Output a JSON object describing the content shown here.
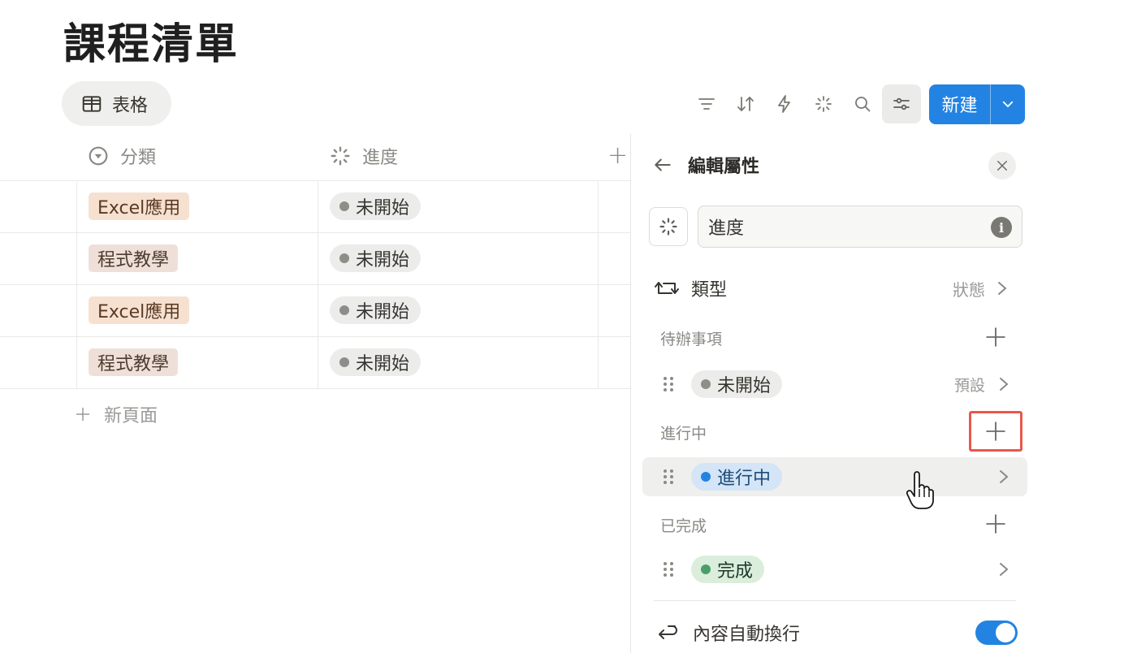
{
  "page": {
    "title": "課程清單"
  },
  "view": {
    "label": "表格"
  },
  "toolbar": {
    "icons": [
      "filter-icon",
      "sort-icon",
      "lightning-icon",
      "sparkle-icon",
      "search-icon",
      "settings-sliders-icon"
    ],
    "new_label": "新建"
  },
  "table": {
    "columns": [
      {
        "label": "分類",
        "icon": "select-icon"
      },
      {
        "label": "進度",
        "icon": "status-icon"
      }
    ],
    "rows": [
      {
        "category": "Excel應用",
        "status": "未開始"
      },
      {
        "category": "程式教學",
        "status": "未開始"
      },
      {
        "category": "Excel應用",
        "status": "未開始"
      },
      {
        "category": "程式教學",
        "status": "未開始"
      }
    ],
    "new_page_label": "新頁面"
  },
  "panel": {
    "title": "編輯屬性",
    "property_name": "進度",
    "type_label": "類型",
    "type_value": "狀態",
    "groups": [
      {
        "name": "待辦事項",
        "option": "未開始",
        "note": "預設",
        "color": "#8f8d88"
      },
      {
        "name": "進行中",
        "option": "進行中",
        "note": "",
        "color": "#2383e2"
      },
      {
        "name": "已完成",
        "option": "完成",
        "note": "",
        "color": "#4a9e6b"
      }
    ],
    "wrap_label": "內容自動換行",
    "wrap_enabled": true
  },
  "colors": {
    "accent": "#2383e2",
    "highlight": "#e8584c"
  }
}
